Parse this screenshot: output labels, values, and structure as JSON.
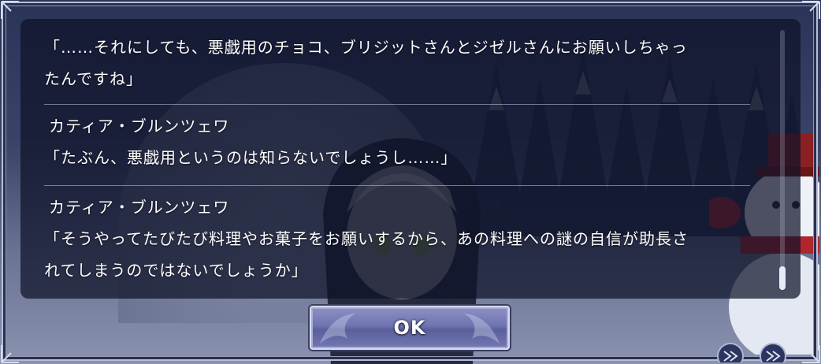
{
  "dialog_log": {
    "entries": [
      {
        "speaker": "",
        "line1": "「……それにしても、悪戯用のチョコ、ブリジットさんとジゼルさんにお願いしちゃっ",
        "line2": "たんですね」"
      },
      {
        "speaker": "カティア・ブルンツェワ",
        "line1": "「たぶん、悪戯用というのは知らないでしょうし……」",
        "line2": ""
      },
      {
        "speaker": "カティア・ブルンツェワ",
        "line1": "「そうやってたびたび料理やお菓子をお願いするから、あの料理への謎の自信が助長さ",
        "line2": "れてしまうのではないでしょうか」"
      }
    ],
    "scroll_position": 1.0
  },
  "ok_button": {
    "label": "OK"
  },
  "colors": {
    "panel_bg": "#0e1228",
    "text": "#ffffff",
    "button_fill": "#6f74b0",
    "frame": "#b7bfd6"
  }
}
